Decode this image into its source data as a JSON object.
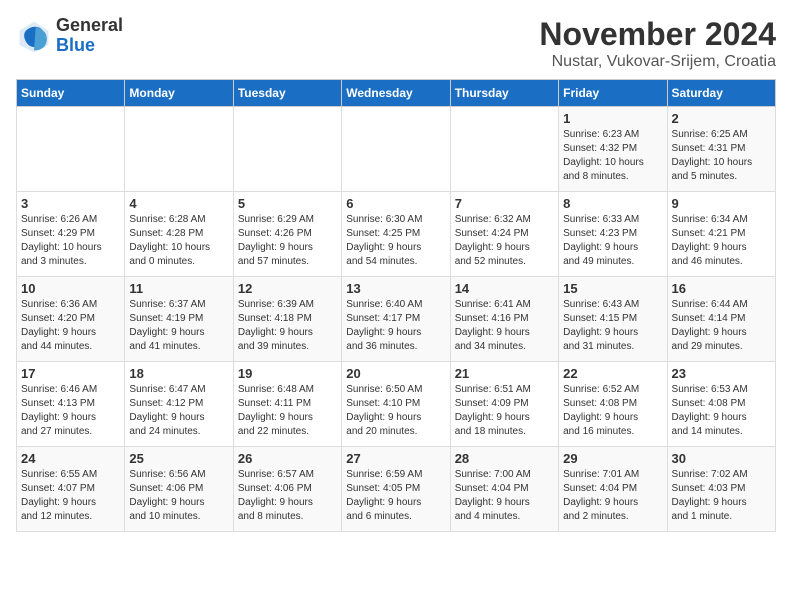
{
  "header": {
    "logo_general": "General",
    "logo_blue": "Blue",
    "title": "November 2024",
    "location": "Nustar, Vukovar-Srijem, Croatia"
  },
  "days_of_week": [
    "Sunday",
    "Monday",
    "Tuesday",
    "Wednesday",
    "Thursday",
    "Friday",
    "Saturday"
  ],
  "weeks": [
    [
      {
        "day": "",
        "detail": ""
      },
      {
        "day": "",
        "detail": ""
      },
      {
        "day": "",
        "detail": ""
      },
      {
        "day": "",
        "detail": ""
      },
      {
        "day": "",
        "detail": ""
      },
      {
        "day": "1",
        "detail": "Sunrise: 6:23 AM\nSunset: 4:32 PM\nDaylight: 10 hours\nand 8 minutes."
      },
      {
        "day": "2",
        "detail": "Sunrise: 6:25 AM\nSunset: 4:31 PM\nDaylight: 10 hours\nand 5 minutes."
      }
    ],
    [
      {
        "day": "3",
        "detail": "Sunrise: 6:26 AM\nSunset: 4:29 PM\nDaylight: 10 hours\nand 3 minutes."
      },
      {
        "day": "4",
        "detail": "Sunrise: 6:28 AM\nSunset: 4:28 PM\nDaylight: 10 hours\nand 0 minutes."
      },
      {
        "day": "5",
        "detail": "Sunrise: 6:29 AM\nSunset: 4:26 PM\nDaylight: 9 hours\nand 57 minutes."
      },
      {
        "day": "6",
        "detail": "Sunrise: 6:30 AM\nSunset: 4:25 PM\nDaylight: 9 hours\nand 54 minutes."
      },
      {
        "day": "7",
        "detail": "Sunrise: 6:32 AM\nSunset: 4:24 PM\nDaylight: 9 hours\nand 52 minutes."
      },
      {
        "day": "8",
        "detail": "Sunrise: 6:33 AM\nSunset: 4:23 PM\nDaylight: 9 hours\nand 49 minutes."
      },
      {
        "day": "9",
        "detail": "Sunrise: 6:34 AM\nSunset: 4:21 PM\nDaylight: 9 hours\nand 46 minutes."
      }
    ],
    [
      {
        "day": "10",
        "detail": "Sunrise: 6:36 AM\nSunset: 4:20 PM\nDaylight: 9 hours\nand 44 minutes."
      },
      {
        "day": "11",
        "detail": "Sunrise: 6:37 AM\nSunset: 4:19 PM\nDaylight: 9 hours\nand 41 minutes."
      },
      {
        "day": "12",
        "detail": "Sunrise: 6:39 AM\nSunset: 4:18 PM\nDaylight: 9 hours\nand 39 minutes."
      },
      {
        "day": "13",
        "detail": "Sunrise: 6:40 AM\nSunset: 4:17 PM\nDaylight: 9 hours\nand 36 minutes."
      },
      {
        "day": "14",
        "detail": "Sunrise: 6:41 AM\nSunset: 4:16 PM\nDaylight: 9 hours\nand 34 minutes."
      },
      {
        "day": "15",
        "detail": "Sunrise: 6:43 AM\nSunset: 4:15 PM\nDaylight: 9 hours\nand 31 minutes."
      },
      {
        "day": "16",
        "detail": "Sunrise: 6:44 AM\nSunset: 4:14 PM\nDaylight: 9 hours\nand 29 minutes."
      }
    ],
    [
      {
        "day": "17",
        "detail": "Sunrise: 6:46 AM\nSunset: 4:13 PM\nDaylight: 9 hours\nand 27 minutes."
      },
      {
        "day": "18",
        "detail": "Sunrise: 6:47 AM\nSunset: 4:12 PM\nDaylight: 9 hours\nand 24 minutes."
      },
      {
        "day": "19",
        "detail": "Sunrise: 6:48 AM\nSunset: 4:11 PM\nDaylight: 9 hours\nand 22 minutes."
      },
      {
        "day": "20",
        "detail": "Sunrise: 6:50 AM\nSunset: 4:10 PM\nDaylight: 9 hours\nand 20 minutes."
      },
      {
        "day": "21",
        "detail": "Sunrise: 6:51 AM\nSunset: 4:09 PM\nDaylight: 9 hours\nand 18 minutes."
      },
      {
        "day": "22",
        "detail": "Sunrise: 6:52 AM\nSunset: 4:08 PM\nDaylight: 9 hours\nand 16 minutes."
      },
      {
        "day": "23",
        "detail": "Sunrise: 6:53 AM\nSunset: 4:08 PM\nDaylight: 9 hours\nand 14 minutes."
      }
    ],
    [
      {
        "day": "24",
        "detail": "Sunrise: 6:55 AM\nSunset: 4:07 PM\nDaylight: 9 hours\nand 12 minutes."
      },
      {
        "day": "25",
        "detail": "Sunrise: 6:56 AM\nSunset: 4:06 PM\nDaylight: 9 hours\nand 10 minutes."
      },
      {
        "day": "26",
        "detail": "Sunrise: 6:57 AM\nSunset: 4:06 PM\nDaylight: 9 hours\nand 8 minutes."
      },
      {
        "day": "27",
        "detail": "Sunrise: 6:59 AM\nSunset: 4:05 PM\nDaylight: 9 hours\nand 6 minutes."
      },
      {
        "day": "28",
        "detail": "Sunrise: 7:00 AM\nSunset: 4:04 PM\nDaylight: 9 hours\nand 4 minutes."
      },
      {
        "day": "29",
        "detail": "Sunrise: 7:01 AM\nSunset: 4:04 PM\nDaylight: 9 hours\nand 2 minutes."
      },
      {
        "day": "30",
        "detail": "Sunrise: 7:02 AM\nSunset: 4:03 PM\nDaylight: 9 hours\nand 1 minute."
      }
    ]
  ]
}
